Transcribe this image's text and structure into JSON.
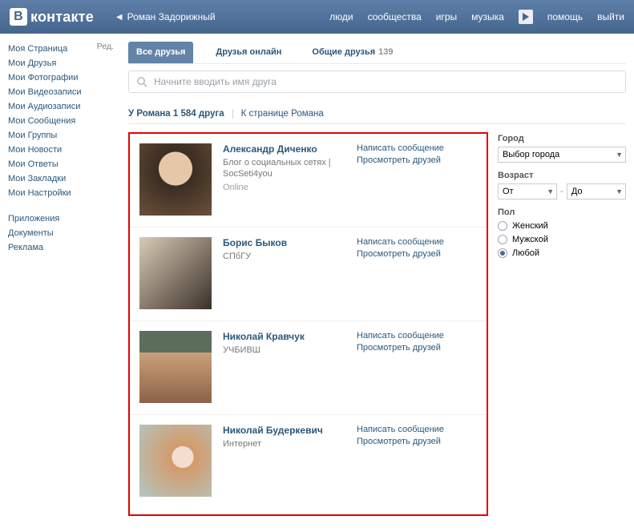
{
  "header": {
    "logo_prefix": "В",
    "logo_rest": "контакте",
    "back_label": "Роман Задорижный",
    "nav": {
      "people": "люди",
      "communities": "сообщества",
      "games": "игры",
      "music": "музыка",
      "help": "помощь",
      "logout": "выйти"
    }
  },
  "sidebar": {
    "edit": "Ред.",
    "items": [
      "Моя Страница",
      "Мои Друзья",
      "Мои Фотографии",
      "Мои Видеозаписи",
      "Мои Аудиозаписи",
      "Мои Сообщения",
      "Мои Группы",
      "Мои Новости",
      "Мои Ответы",
      "Мои Закладки",
      "Мои Настройки"
    ],
    "items2": [
      "Приложения",
      "Документы",
      "Реклама"
    ]
  },
  "tabs": {
    "all": "Все друзья",
    "online": "Друзья онлайн",
    "mutual_label": "Общие друзья",
    "mutual_count": "139"
  },
  "search": {
    "placeholder": "Начните вводить имя друга"
  },
  "list_header": {
    "title": "У Романа 1 584 друга",
    "back": "К странице Романа"
  },
  "actions": {
    "message": "Написать сообщение",
    "view_friends": "Просмотреть друзей"
  },
  "friends": [
    {
      "name": "Александр Диченко",
      "sub": "Блог о социальных сетях | SocSeti4you",
      "online": "Online"
    },
    {
      "name": "Борис Быков",
      "sub": "СПбГУ",
      "online": ""
    },
    {
      "name": "Николай Кравчук",
      "sub": "УЧБИВШ",
      "online": ""
    },
    {
      "name": "Николай Будеркевич",
      "sub": "Интернет",
      "online": ""
    }
  ],
  "filters": {
    "city_label": "Город",
    "city_value": "Выбор города",
    "age_label": "Возраст",
    "age_from": "От",
    "age_to": "До",
    "sex_label": "Пол",
    "sex_female": "Женский",
    "sex_male": "Мужской",
    "sex_any": "Любой"
  }
}
